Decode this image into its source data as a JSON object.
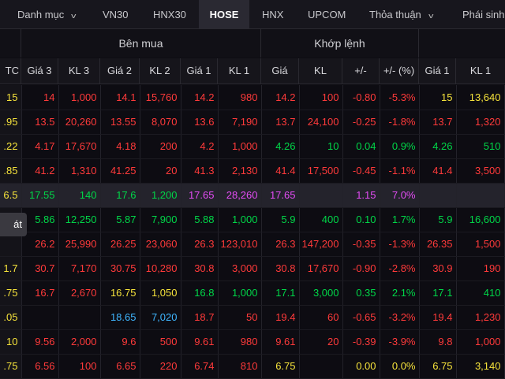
{
  "tabs": [
    {
      "label": "Danh mục"
    },
    {
      "label": "VN30"
    },
    {
      "label": "HNX30"
    },
    {
      "label": "HOSE"
    },
    {
      "label": "HNX"
    },
    {
      "label": "UPCOM"
    },
    {
      "label": "Thỏa thuận"
    },
    {
      "label": "Phái sinh"
    }
  ],
  "groups": {
    "buy": "Bên mua",
    "match": "Khớp lệnh"
  },
  "columns": {
    "ref_partial": "TC",
    "buy": [
      "Giá 3",
      "KL 3",
      "Giá 2",
      "KL 2",
      "Giá 1",
      "KL 1"
    ],
    "match": [
      "Giá",
      "KL",
      "+/-",
      "+/- (%)"
    ],
    "sell": [
      "Giá 1",
      "KL 1"
    ]
  },
  "tooltip_text": "át",
  "colors": {
    "red": "#ff3a3a",
    "green": "#00d648",
    "yellow": "#f6e33b",
    "purple": "#e44cf5",
    "blue": "#3fb6ff"
  },
  "rows": [
    {
      "ref": "15",
      "ref_c": "yellow",
      "cells": [
        [
          "14",
          "red"
        ],
        [
          "1,000",
          "red"
        ],
        [
          "14.1",
          "red"
        ],
        [
          "15,760",
          "red"
        ],
        [
          "14.2",
          "red"
        ],
        [
          "980",
          "red"
        ],
        [
          "14.2",
          "red"
        ],
        [
          "100",
          "red"
        ],
        [
          "-0.80",
          "red"
        ],
        [
          "-5.3%",
          "red"
        ],
        [
          "15",
          "yellow"
        ],
        [
          "13,640",
          "yellow"
        ]
      ]
    },
    {
      "ref": ".95",
      "ref_c": "yellow",
      "cells": [
        [
          "13.5",
          "red"
        ],
        [
          "20,260",
          "red"
        ],
        [
          "13.55",
          "red"
        ],
        [
          "8,070",
          "red"
        ],
        [
          "13.6",
          "red"
        ],
        [
          "7,190",
          "red"
        ],
        [
          "13.7",
          "red"
        ],
        [
          "24,100",
          "red"
        ],
        [
          "-0.25",
          "red"
        ],
        [
          "-1.8%",
          "red"
        ],
        [
          "13.7",
          "red"
        ],
        [
          "1,320",
          "red"
        ]
      ]
    },
    {
      "ref": ".22",
      "ref_c": "yellow",
      "cells": [
        [
          "4.17",
          "red"
        ],
        [
          "17,670",
          "red"
        ],
        [
          "4.18",
          "red"
        ],
        [
          "200",
          "red"
        ],
        [
          "4.2",
          "red"
        ],
        [
          "1,000",
          "red"
        ],
        [
          "4.26",
          "green"
        ],
        [
          "10",
          "green"
        ],
        [
          "0.04",
          "green"
        ],
        [
          "0.9%",
          "green"
        ],
        [
          "4.26",
          "green"
        ],
        [
          "510",
          "green"
        ]
      ]
    },
    {
      "ref": ".85",
      "ref_c": "yellow",
      "cells": [
        [
          "41.2",
          "red"
        ],
        [
          "1,310",
          "red"
        ],
        [
          "41.25",
          "red"
        ],
        [
          "20",
          "red"
        ],
        [
          "41.3",
          "red"
        ],
        [
          "2,130",
          "red"
        ],
        [
          "41.4",
          "red"
        ],
        [
          "17,500",
          "red"
        ],
        [
          "-0.45",
          "red"
        ],
        [
          "-1.1%",
          "red"
        ],
        [
          "41.4",
          "red"
        ],
        [
          "3,500",
          "red"
        ]
      ]
    },
    {
      "ref": "6.5",
      "ref_c": "yellow",
      "hl": true,
      "cells": [
        [
          "17.55",
          "green"
        ],
        [
          "140",
          "green"
        ],
        [
          "17.6",
          "green"
        ],
        [
          "1,200",
          "green"
        ],
        [
          "17.65",
          "purple"
        ],
        [
          "28,260",
          "purple"
        ],
        [
          "17.65",
          "purple"
        ],
        [
          "",
          ""
        ],
        [
          "1.15",
          "purple"
        ],
        [
          "7.0%",
          "purple"
        ],
        [
          "",
          ""
        ],
        [
          "",
          ""
        ]
      ]
    },
    {
      "ref": "",
      "ref_c": "yellow",
      "cells": [
        [
          "5.86",
          "green"
        ],
        [
          "12,250",
          "green"
        ],
        [
          "5.87",
          "green"
        ],
        [
          "7,900",
          "green"
        ],
        [
          "5.88",
          "green"
        ],
        [
          "1,000",
          "green"
        ],
        [
          "5.9",
          "green"
        ],
        [
          "400",
          "green"
        ],
        [
          "0.10",
          "green"
        ],
        [
          "1.7%",
          "green"
        ],
        [
          "5.9",
          "green"
        ],
        [
          "16,600",
          "green"
        ]
      ]
    },
    {
      "ref": "",
      "ref_c": "yellow",
      "cells": [
        [
          "26.2",
          "red"
        ],
        [
          "25,990",
          "red"
        ],
        [
          "26.25",
          "red"
        ],
        [
          "23,060",
          "red"
        ],
        [
          "26.3",
          "red"
        ],
        [
          "123,010",
          "red"
        ],
        [
          "26.3",
          "red"
        ],
        [
          "147,200",
          "red"
        ],
        [
          "-0.35",
          "red"
        ],
        [
          "-1.3%",
          "red"
        ],
        [
          "26.35",
          "red"
        ],
        [
          "1,500",
          "red"
        ]
      ]
    },
    {
      "ref": "1.7",
      "ref_c": "yellow",
      "cells": [
        [
          "30.7",
          "red"
        ],
        [
          "7,170",
          "red"
        ],
        [
          "30.75",
          "red"
        ],
        [
          "10,280",
          "red"
        ],
        [
          "30.8",
          "red"
        ],
        [
          "3,000",
          "red"
        ],
        [
          "30.8",
          "red"
        ],
        [
          "17,670",
          "red"
        ],
        [
          "-0.90",
          "red"
        ],
        [
          "-2.8%",
          "red"
        ],
        [
          "30.9",
          "red"
        ],
        [
          "190",
          "red"
        ]
      ]
    },
    {
      "ref": ".75",
      "ref_c": "yellow",
      "cells": [
        [
          "16.7",
          "red"
        ],
        [
          "2,670",
          "red"
        ],
        [
          "16.75",
          "yellow"
        ],
        [
          "1,050",
          "yellow"
        ],
        [
          "16.8",
          "green"
        ],
        [
          "1,000",
          "green"
        ],
        [
          "17.1",
          "green"
        ],
        [
          "3,000",
          "green"
        ],
        [
          "0.35",
          "green"
        ],
        [
          "2.1%",
          "green"
        ],
        [
          "17.1",
          "green"
        ],
        [
          "410",
          "green"
        ]
      ]
    },
    {
      "ref": ".05",
      "ref_c": "yellow",
      "cells": [
        [
          "",
          ""
        ],
        [
          "",
          ""
        ],
        [
          "18.65",
          "blue"
        ],
        [
          "7,020",
          "blue"
        ],
        [
          "18.7",
          "red"
        ],
        [
          "50",
          "red"
        ],
        [
          "19.4",
          "red"
        ],
        [
          "60",
          "red"
        ],
        [
          "-0.65",
          "red"
        ],
        [
          "-3.2%",
          "red"
        ],
        [
          "19.4",
          "red"
        ],
        [
          "1,230",
          "red"
        ]
      ]
    },
    {
      "ref": "10",
      "ref_c": "yellow",
      "cells": [
        [
          "9.56",
          "red"
        ],
        [
          "2,000",
          "red"
        ],
        [
          "9.6",
          "red"
        ],
        [
          "500",
          "red"
        ],
        [
          "9.61",
          "red"
        ],
        [
          "980",
          "red"
        ],
        [
          "9.61",
          "red"
        ],
        [
          "20",
          "red"
        ],
        [
          "-0.39",
          "red"
        ],
        [
          "-3.9%",
          "red"
        ],
        [
          "9.8",
          "red"
        ],
        [
          "1,000",
          "red"
        ]
      ]
    },
    {
      "ref": ".75",
      "ref_c": "yellow",
      "cells": [
        [
          "6.56",
          "red"
        ],
        [
          "100",
          "red"
        ],
        [
          "6.65",
          "red"
        ],
        [
          "220",
          "red"
        ],
        [
          "6.74",
          "red"
        ],
        [
          "810",
          "red"
        ],
        [
          "6.75",
          "yellow"
        ],
        [
          "",
          ""
        ],
        [
          "0.00",
          "yellow"
        ],
        [
          "0.0%",
          "yellow"
        ],
        [
          "6.75",
          "yellow"
        ],
        [
          "3,140",
          "yellow"
        ]
      ]
    }
  ]
}
